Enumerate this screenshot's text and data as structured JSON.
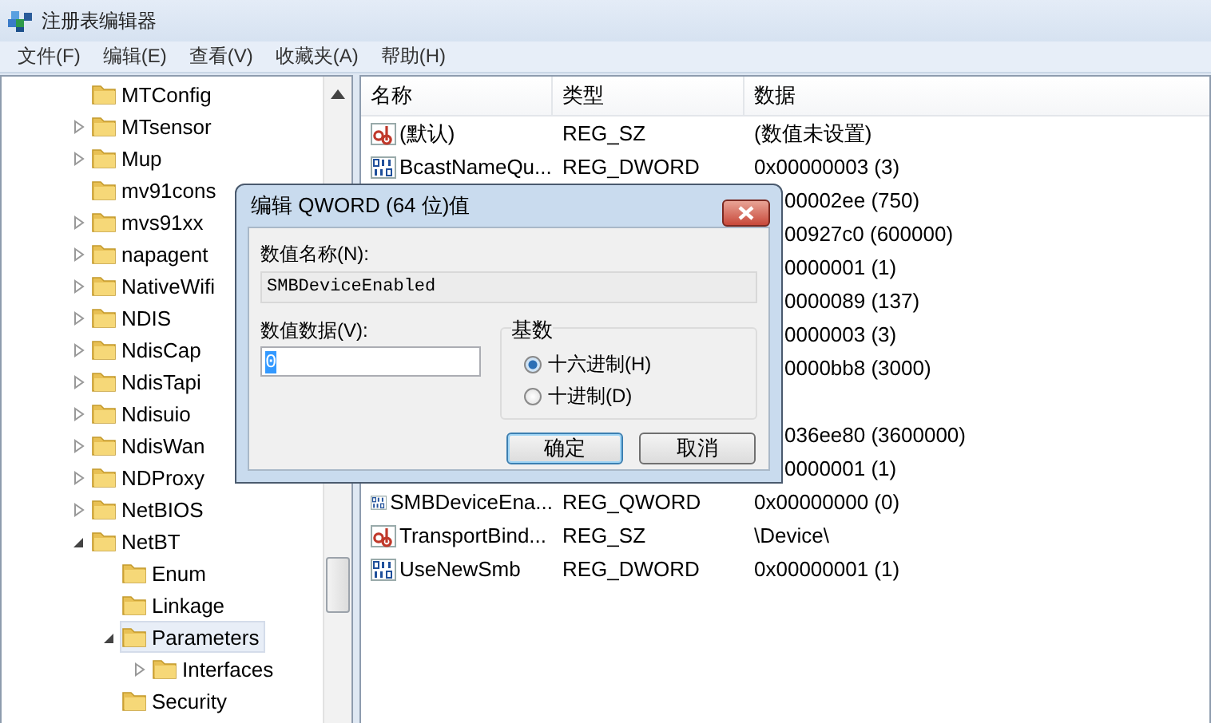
{
  "window": {
    "title": "注册表编辑器"
  },
  "menu": [
    "文件(F)",
    "编辑(E)",
    "查看(V)",
    "收藏夹(A)",
    "帮助(H)"
  ],
  "tree": {
    "items": [
      {
        "label": "MTConfig"
      },
      {
        "label": "MTsensor",
        "expanded": false
      },
      {
        "label": "Mup",
        "expanded": false
      },
      {
        "label": "mv91cons"
      },
      {
        "label": "mvs91xx",
        "expanded": false
      },
      {
        "label": "napagent",
        "expanded": false
      },
      {
        "label": "NativeWifi",
        "expanded": false
      },
      {
        "label": "NDIS",
        "expanded": false
      },
      {
        "label": "NdisCap",
        "expanded": false
      },
      {
        "label": "NdisTapi",
        "expanded": false
      },
      {
        "label": "Ndisuio",
        "expanded": false
      },
      {
        "label": "NdisWan",
        "expanded": false
      },
      {
        "label": "NDProxy",
        "expanded": false
      },
      {
        "label": "NetBIOS",
        "expanded": false
      },
      {
        "label": "NetBT",
        "expanded": true,
        "children": [
          {
            "label": "Enum",
            "selected": false
          },
          {
            "label": "Linkage",
            "selected": false
          },
          {
            "label": "Parameters",
            "expanded": true,
            "selected": true,
            "children": [
              {
                "label": "Interfaces",
                "expanded": false
              }
            ]
          },
          {
            "label": "Security",
            "selected": false
          }
        ]
      }
    ]
  },
  "values": {
    "columns": [
      "名称",
      "类型",
      "数据"
    ],
    "rows": [
      {
        "kind": "string",
        "name": "(默认)",
        "type": "REG_SZ",
        "data": "(数值未设置)"
      },
      {
        "kind": "binary",
        "name": "BcastNameQu...",
        "type": "REG_DWORD",
        "data": "0x00000003 (3)"
      },
      {
        "kind": "covered",
        "data": "00002ee (750)"
      },
      {
        "kind": "covered",
        "data": "00927c0 (600000)"
      },
      {
        "kind": "covered",
        "data": "0000001 (1)"
      },
      {
        "kind": "covered",
        "data": "0000089 (137)"
      },
      {
        "kind": "covered",
        "data": "0000003 (3)"
      },
      {
        "kind": "covered",
        "data": "0000bb8 (3000)"
      },
      {
        "kind": "covered"
      },
      {
        "kind": "covered",
        "data": "036ee80 (3600000)"
      },
      {
        "kind": "covered",
        "data": "0000001 (1)"
      },
      {
        "kind": "binary",
        "name": "SMBDeviceEna...",
        "type": "REG_QWORD",
        "data": "0x00000000 (0)"
      },
      {
        "kind": "string",
        "name": "TransportBind...",
        "type": "REG_SZ",
        "data": "\\Device\\"
      },
      {
        "kind": "binary",
        "name": "UseNewSmb",
        "type": "REG_DWORD",
        "data": "0x00000001 (1)"
      }
    ]
  },
  "dialog": {
    "title": "编辑 QWORD (64 位)值",
    "name_label": "数值名称(N):",
    "name_value": "SMBDeviceEnabled",
    "data_label": "数值数据(V):",
    "data_value": "0",
    "base": {
      "label": "基数",
      "options": [
        {
          "label": "十六进制(H)",
          "selected": true
        },
        {
          "label": "十进制(D)",
          "selected": false
        }
      ]
    },
    "buttons": [
      {
        "label": "确定",
        "default": true
      },
      {
        "label": "取消",
        "default": false
      }
    ]
  }
}
